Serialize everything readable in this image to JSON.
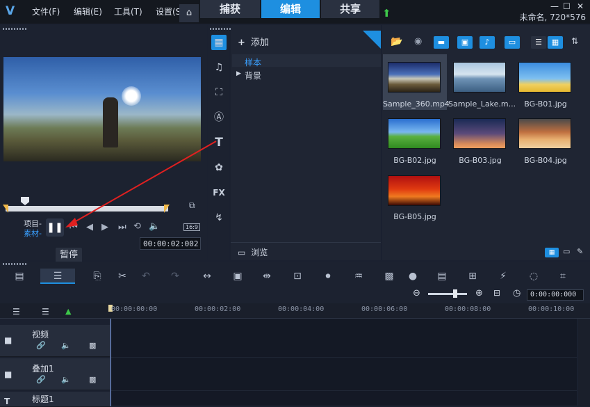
{
  "menu": {
    "file": "文件(F)",
    "edit": "编辑(E)",
    "tools": "工具(T)",
    "settings": "设置(S)"
  },
  "tabs": {
    "capture": "捕获",
    "edit": "编辑",
    "share": "共享"
  },
  "window": {
    "project_info": "未命名, 720*576"
  },
  "player": {
    "project_label": "项目-",
    "clip_label": "素材-",
    "timecode": "00:00:02:002",
    "aspect": "16:9",
    "tooltip": "暂停"
  },
  "library": {
    "add_label": "添加",
    "tree_sample": "样本",
    "tree_background": "背景",
    "browse_label": "浏览"
  },
  "media": {
    "items": [
      {
        "label": "Sample_360.mp4",
        "selected": true
      },
      {
        "label": "Sample_Lake.m..."
      },
      {
        "label": "BG-B01.jpg"
      },
      {
        "label": "BG-B02.jpg"
      },
      {
        "label": "BG-B03.jpg"
      },
      {
        "label": "BG-B04.jpg"
      },
      {
        "label": "BG-B05.jpg"
      }
    ]
  },
  "timeline": {
    "timecode": "0:00:00:000",
    "ruler": [
      "00:00:00:00",
      "00:00:02:00",
      "00:00:04:00",
      "00:00:06:00",
      "00:00:08:00",
      "00:00:10:00"
    ],
    "tracks": [
      {
        "name": "视频"
      },
      {
        "name": "叠加1"
      },
      {
        "name": "标题1"
      }
    ]
  },
  "colors": {
    "accent": "#1e8fe0",
    "selection": "#3aa0ff",
    "annotation_arrow": "#e02020"
  }
}
